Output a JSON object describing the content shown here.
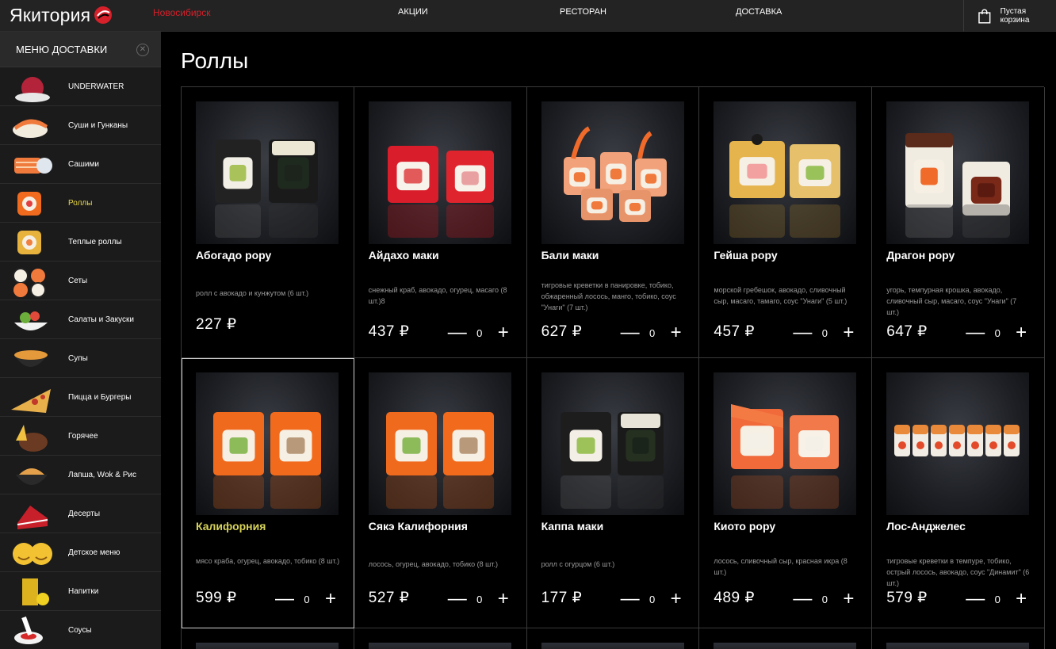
{
  "header": {
    "logo_text": "Якитория",
    "city": "Новосибирск",
    "nav": {
      "promo": "АКЦИИ",
      "restaurant": "РЕСТОРАН",
      "delivery": "ДОСТАВКА"
    },
    "cart_label": "Пустая корзина",
    "brand_color": "#d6202a"
  },
  "sidebar": {
    "title": "МЕНЮ ДОСТАВКИ",
    "items": [
      {
        "label": "UNDERWATER",
        "icon": "tuna-dish-icon",
        "active": false
      },
      {
        "label": "Суши и Гунканы",
        "icon": "nigiri-icon",
        "active": false
      },
      {
        "label": "Сашими",
        "icon": "sashimi-icon",
        "active": false
      },
      {
        "label": "Роллы",
        "icon": "roll-icon",
        "active": true
      },
      {
        "label": "Теплые роллы",
        "icon": "warm-roll-icon",
        "active": false
      },
      {
        "label": "Сеты",
        "icon": "set-icon",
        "active": false
      },
      {
        "label": "Салаты и Закуски",
        "icon": "salad-icon",
        "active": false
      },
      {
        "label": "Супы",
        "icon": "soup-icon",
        "active": false
      },
      {
        "label": "Пицца и Бургеры",
        "icon": "pizza-icon",
        "active": false
      },
      {
        "label": "Горячее",
        "icon": "hot-dish-icon",
        "active": false
      },
      {
        "label": "Лапша, Wok & Рис",
        "icon": "noodles-icon",
        "active": false
      },
      {
        "label": "Десерты",
        "icon": "cake-icon",
        "active": false
      },
      {
        "label": "Детское меню",
        "icon": "smiley-potato-icon",
        "active": false
      },
      {
        "label": "Напитки",
        "icon": "drink-icon",
        "active": false
      },
      {
        "label": "Соусы",
        "icon": "sauce-icon",
        "active": false
      }
    ]
  },
  "main": {
    "title": "Роллы",
    "products": [
      {
        "name": "Абогадо рору",
        "desc": "ролл с авокадо и кунжутом (6 шт.)",
        "price": "227 ₽",
        "qty": null,
        "highlight": false,
        "style": "avocado"
      },
      {
        "name": "Айдахо маки",
        "desc": "снежный краб, авокадо, огурец, масаго (8 шт.)8",
        "price": "437 ₽",
        "qty": "0",
        "highlight": false,
        "style": "red"
      },
      {
        "name": "Бали маки",
        "desc": "тигровые креветки в панировке, тобико, обжаренный лосось, манго, тобико, соус \"Унаги\" (7 шт.)",
        "price": "627 ₽",
        "qty": "0",
        "highlight": false,
        "style": "shrimp"
      },
      {
        "name": "Гейша рору",
        "desc": "морской гребешок, авокадо, сливочный сыр, масаго, тамаго, соус \"Унаги\" (5 шт.)",
        "price": "457 ₽",
        "qty": "0",
        "highlight": false,
        "style": "tamago"
      },
      {
        "name": "Драгон рору",
        "desc": "угорь, темпурная крошка, авокадо, сливочный сыр, масаго, соус \"Унаги\" (7 шт.)",
        "price": "647 ₽",
        "qty": "0",
        "highlight": false,
        "style": "eel"
      },
      {
        "name": "Калифорния",
        "desc": "мясо краба, огурец, авокадо, тобико (8 шт.)",
        "price": "599 ₽",
        "qty": "0",
        "highlight": true,
        "style": "orange"
      },
      {
        "name": "Сякэ Калифорния",
        "desc": "лосось, огурец, авокадо, тобико (8 шт.)",
        "price": "527 ₽",
        "qty": "0",
        "highlight": false,
        "style": "orange"
      },
      {
        "name": "Каппа маки",
        "desc": "ролл с огурцом (6 шт.)",
        "price": "177 ₽",
        "qty": "0",
        "highlight": false,
        "style": "kappa"
      },
      {
        "name": "Киото рору",
        "desc": "лосось, сливочный сыр, красная икра (8 шт.)",
        "price": "489 ₽",
        "qty": "0",
        "highlight": false,
        "style": "salmon"
      },
      {
        "name": "Лос-Анджелес",
        "desc": "тигровые креветки в темпуре, тобико, острый лосось, авокадо, соус \"Динамит\" (6 шт.)",
        "price": "579 ₽",
        "qty": "0",
        "highlight": false,
        "style": "row"
      }
    ]
  }
}
